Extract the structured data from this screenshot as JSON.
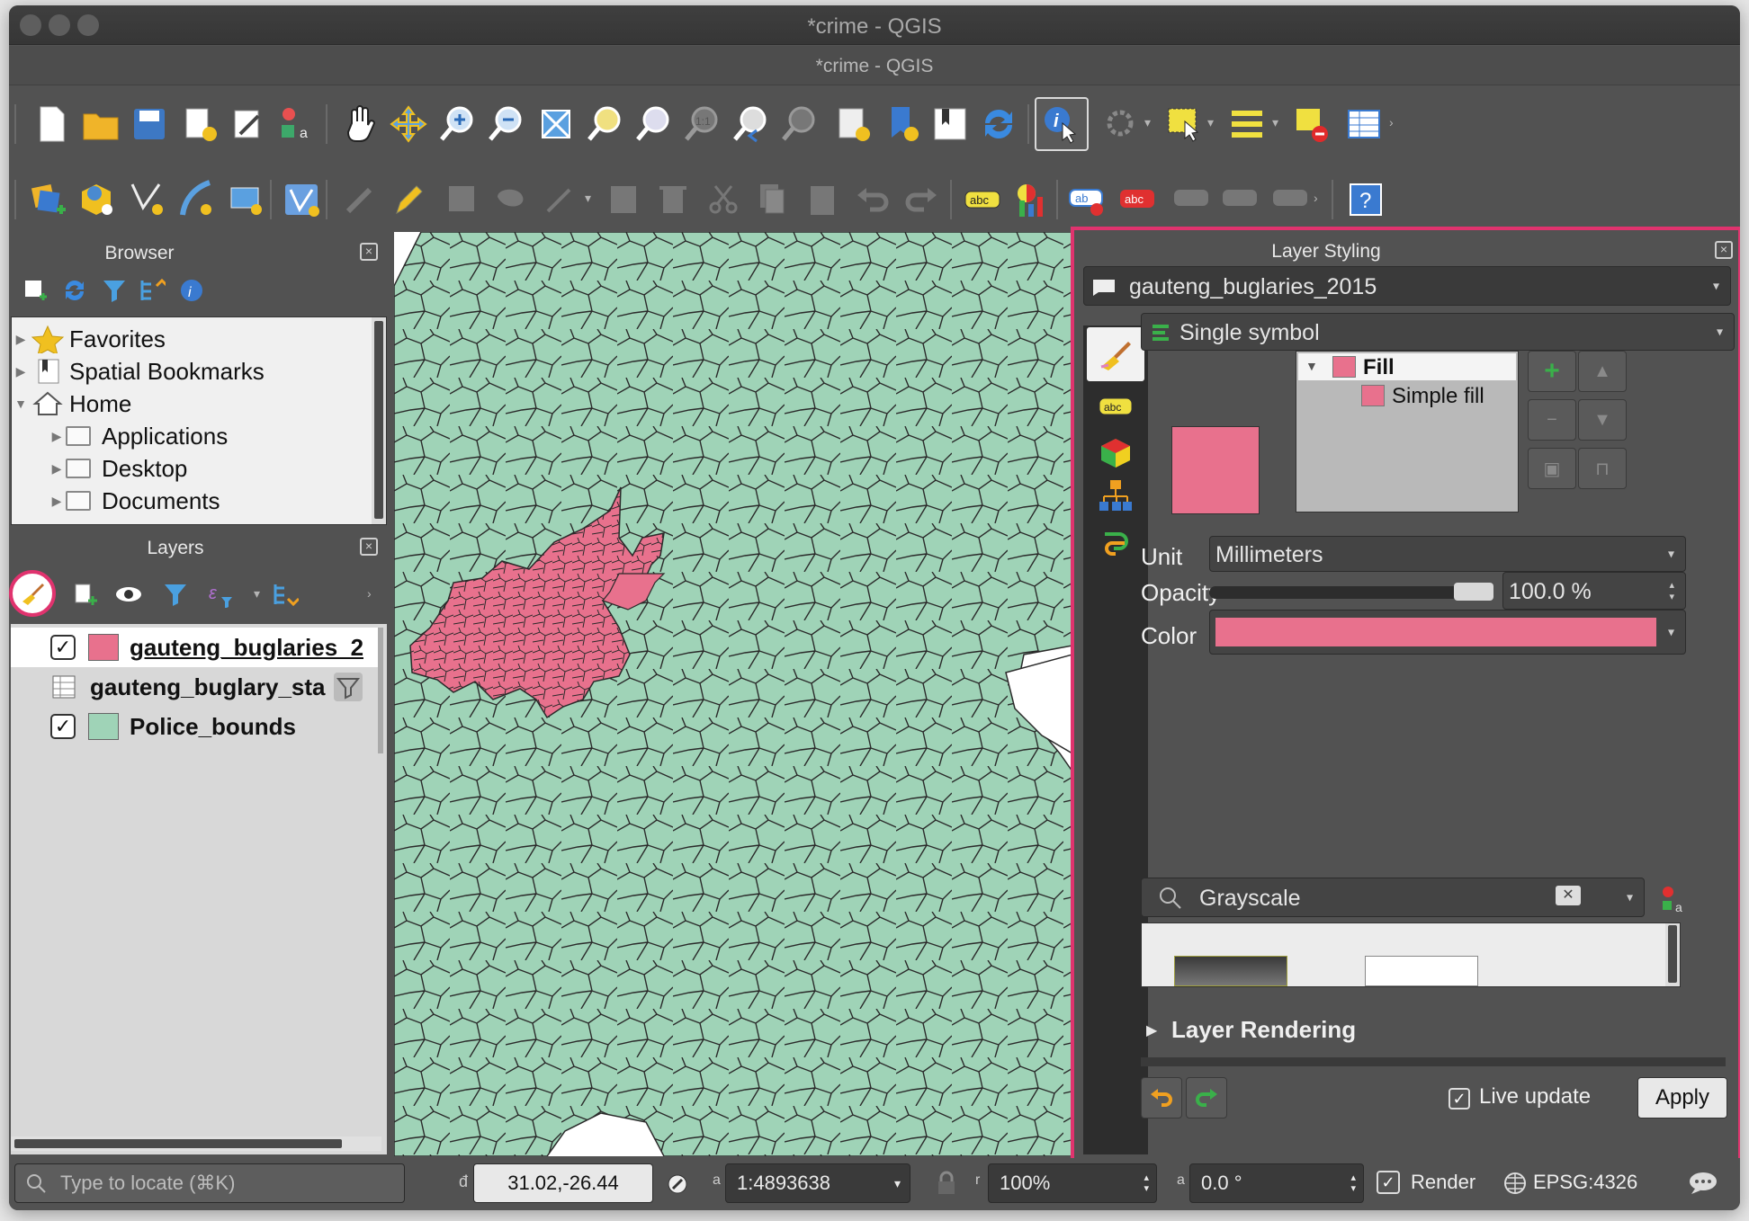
{
  "window": {
    "title": "*crime - QGIS",
    "subtitle": "*crime - QGIS"
  },
  "browser": {
    "title": "Browser",
    "items": [
      {
        "label": "Favorites",
        "icon": "star-icon"
      },
      {
        "label": "Spatial Bookmarks",
        "icon": "bookmark-icon"
      },
      {
        "label": "Home",
        "icon": "home-icon"
      },
      {
        "label": "Applications",
        "icon": "folder-icon"
      },
      {
        "label": "Desktop",
        "icon": "folder-icon"
      },
      {
        "label": "Documents",
        "icon": "folder-icon"
      }
    ]
  },
  "layers": {
    "title": "Layers",
    "items": [
      {
        "label": "gauteng_buglaries_2",
        "checked": true,
        "swatch": "#e8718d"
      },
      {
        "label": "gauteng_buglary_sta",
        "checked": false,
        "swatch": "table"
      },
      {
        "label": "Police_bounds",
        "checked": true,
        "swatch": "#9fd3b7"
      }
    ]
  },
  "styling": {
    "title": "Layer Styling",
    "layer_select": "gauteng_buglaries_2015",
    "renderer": "Single symbol",
    "symbol_tree": {
      "root": "Fill",
      "child": "Simple fill"
    },
    "unit_label": "Unit",
    "unit_value": "Millimeters",
    "opacity_label": "Opacity",
    "opacity_value": "100.0 %",
    "color_label": "Color",
    "color": "#e8718d",
    "search_value": "Grayscale",
    "layer_rendering": "Layer Rendering",
    "live_update": "Live update",
    "apply": "Apply"
  },
  "statusbar": {
    "locate_placeholder": "Type to locate (⌘K)",
    "coordinate": "31.02,-26.44",
    "scale": "1:4893638",
    "magnifier": "100%",
    "rotation": "0.0 °",
    "render": "Render",
    "crs": "EPSG:4326"
  },
  "colors": {
    "accent_highlight": "#e0336e",
    "map_fill": "#9fd3b7",
    "layer_fill": "#e8718d"
  }
}
